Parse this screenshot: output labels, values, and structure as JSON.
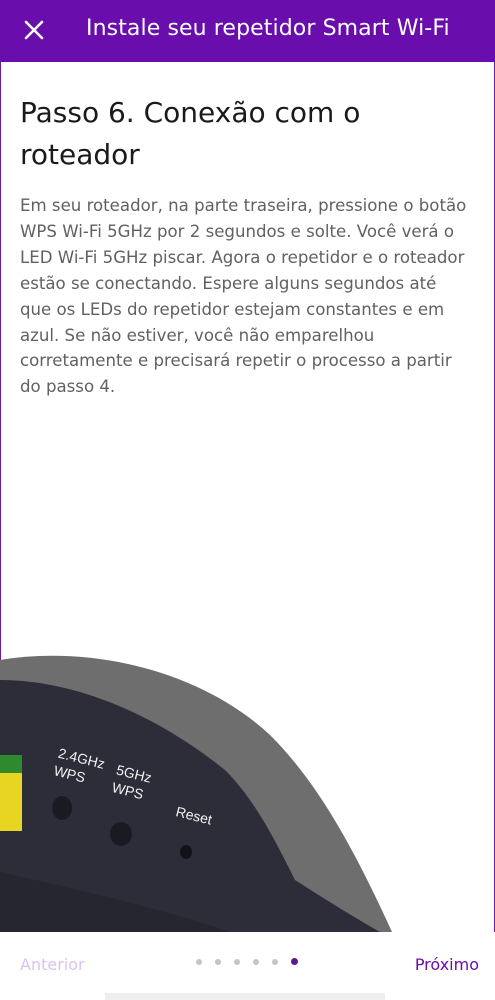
{
  "header": {
    "title": "Instale seu repetidor Smart Wi-Fi",
    "close_icon": "close-icon"
  },
  "step": {
    "heading": "Passo 6. Conexão com o roteador",
    "description": "Em seu roteador, na parte traseira, pressione o botão WPS Wi-Fi 5GHz por 2 segundos e solte. Você verá o LED Wi-Fi 5GHz piscar. Agora o repetidor e o roteador estão se conectando. Espere alguns segundos até que os LEDs do repetidor estejam constantes e em azul. Se não estiver, você não emparelhou corretamente e precisará repetir o processo a partir do passo 4."
  },
  "illustration": {
    "label_24": "2.4GHz",
    "label_24_wps": "WPS",
    "label_5": "5GHz",
    "label_5_wps": "WPS",
    "label_reset": "Reset"
  },
  "navigation": {
    "prev_label": "Anterior",
    "next_label": "Próximo",
    "total_steps": 6,
    "current_step": 6
  },
  "colors": {
    "brand": "#6a0dad",
    "disabled": "#d9c3ec",
    "text_secondary": "#616161"
  }
}
